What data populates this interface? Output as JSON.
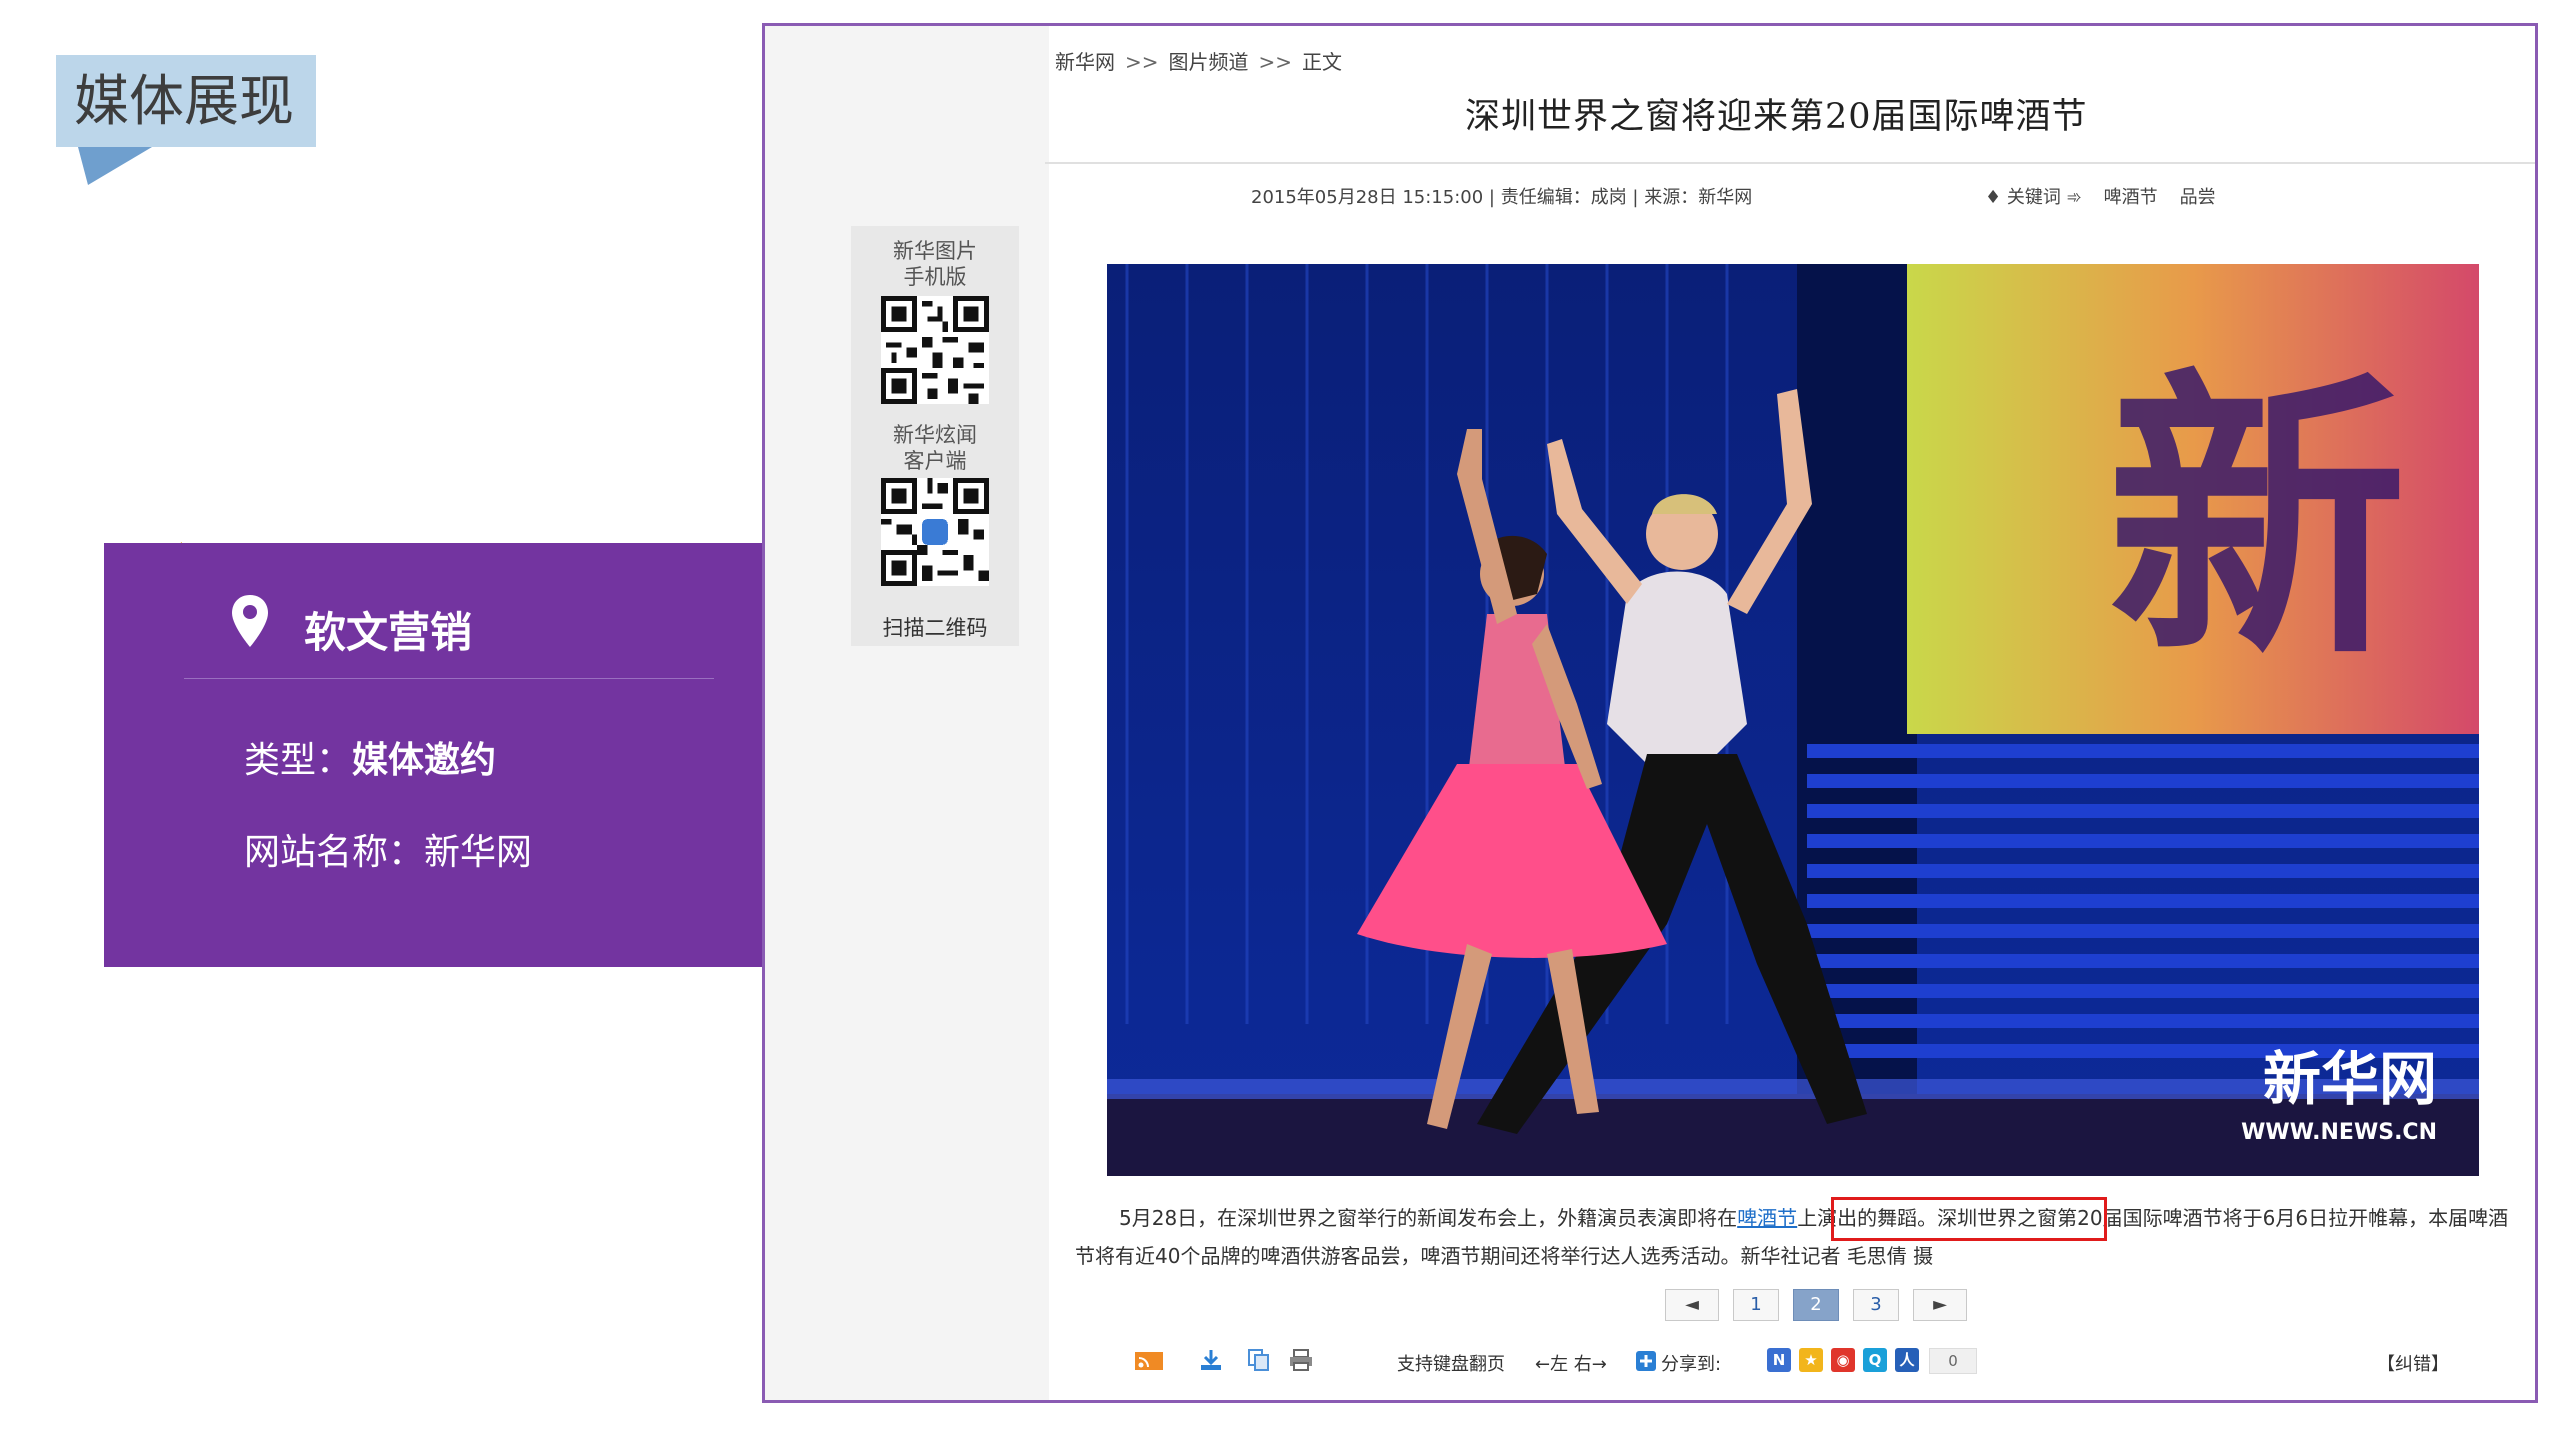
{
  "slide": {
    "title": "媒体展现"
  },
  "card": {
    "heading": "软文营销",
    "type_label": "类型：",
    "type_value": "媒体邀约",
    "site_label": "网站名称：",
    "site_value": "新华网"
  },
  "article": {
    "breadcrumb": [
      "新华网",
      "图片频道",
      "正文"
    ],
    "breadcrumb_sep": ">>",
    "headline": "深圳世界之窗将迎来第20届国际啤酒节",
    "meta": "2015年05月28日 15:15:00 | 责任编辑：成岗 | 来源：新华网",
    "keywords_label": "♦ 关键词 ➾",
    "keywords": [
      "啤酒节",
      "品尝"
    ],
    "qr": {
      "label1": "新华图片\n手机版",
      "label1_a": "新华图片",
      "label1_b": "手机版",
      "label2_a": "新华炫闻",
      "label2_b": "客户端",
      "scan": "扫描二维码"
    },
    "photo_watermark": "新华网",
    "photo_watermark_url": "WWW.NEWS.CN",
    "caption_part1": "5月28日，在深圳世界之窗举行的新闻发布会上，外籍演员表演即将在",
    "caption_link": "啤酒节",
    "caption_part2": "上演出的舞蹈。深圳世界之窗第20届国际啤酒节将于6月6日拉开帷幕，本届啤酒节将有近40个品牌的啤酒供游客品尝，啤酒节期间还将举行达人选秀活动。新华社记者 毛思倩 摄",
    "pager": {
      "prev": "◄",
      "pages": [
        "1",
        "2",
        "3"
      ],
      "active_page": "2",
      "next": "►"
    },
    "toolbar": {
      "keyboard_text": "支持键盘翻页",
      "keyboard_keys": "←左 右→",
      "share_label": "分享到:",
      "share_count": "0",
      "correction": "【纠错】"
    }
  },
  "colors": {
    "card_purple": "#7334a0",
    "tag_blue": "#bcd6ea",
    "highlight_red": "#e01b1b",
    "fold_gold": "#d9a52b"
  }
}
